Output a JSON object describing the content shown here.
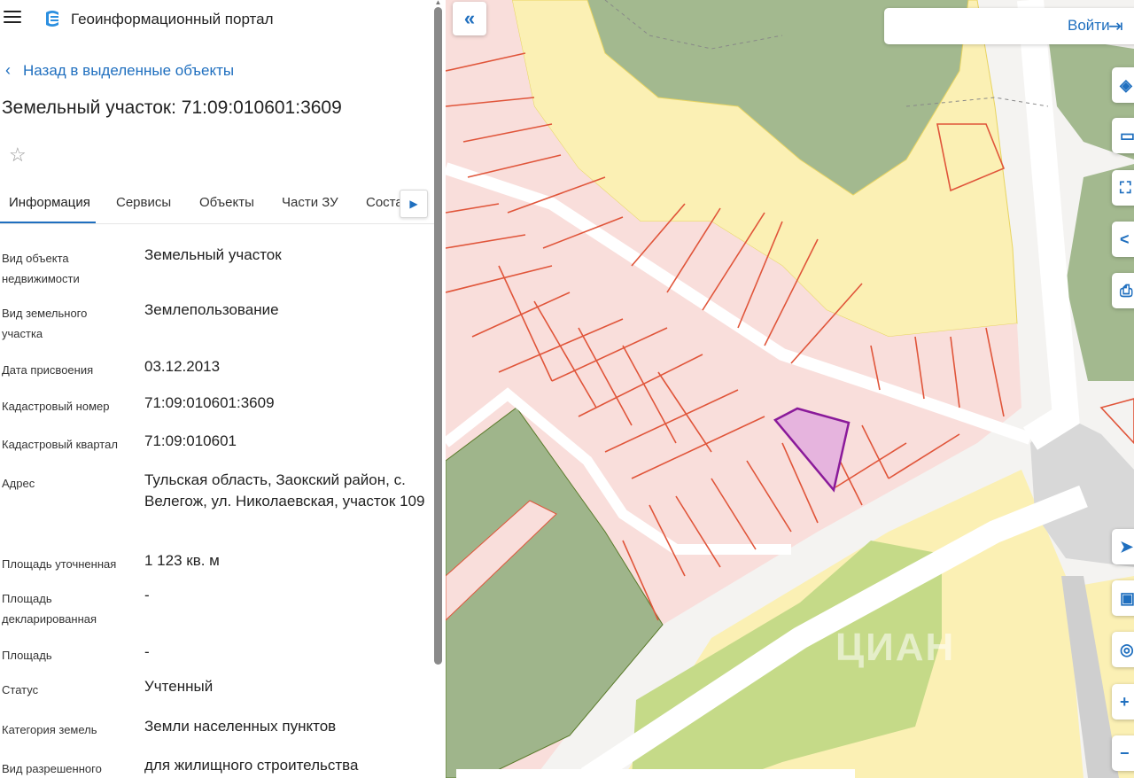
{
  "header": {
    "app_title": "Геоинформационный портал",
    "menu_icon": "menu-icon",
    "logo_icon": "portal-logo-icon"
  },
  "nav": {
    "back_label": "Назад в выделенные объекты"
  },
  "object": {
    "title": "Земельный участок: 71:09:010601:3609"
  },
  "tabs": [
    {
      "label": "Информация"
    },
    {
      "label": "Сервисы"
    },
    {
      "label": "Объекты"
    },
    {
      "label": "Части ЗУ"
    },
    {
      "label": "Состав"
    }
  ],
  "fields": [
    {
      "label": "Вид объекта недвижимости",
      "value": "Земельный участок"
    },
    {
      "label": "Вид земельного участка",
      "value": "Землепользование"
    },
    {
      "label": "Дата присвоения",
      "value": "03.12.2013"
    },
    {
      "label": "Кадастровый номер",
      "value": "71:09:010601:3609"
    },
    {
      "label": "Кадастровый квартал",
      "value": "71:09:010601"
    },
    {
      "label": "Адрес",
      "value": "Тульская область, Заокский район, с. Велегож, ул. Николаевская, участок 109"
    },
    {
      "label": "Площадь уточненная",
      "value": "1 123 кв. м"
    },
    {
      "label": "Площадь декларированная",
      "value": "-"
    },
    {
      "label": "Площадь",
      "value": "-"
    },
    {
      "label": "Статус",
      "value": "Учтенный"
    },
    {
      "label": "Категория земель",
      "value": "Земли населенных пунктов"
    },
    {
      "label": "Вид разрешенного",
      "value": "для жилищного строительства"
    }
  ],
  "map": {
    "login_label": "Войти",
    "collapse_icon": "double-chevron-left-icon",
    "zoom_in": "+",
    "zoom_out": "−",
    "watermark": "ЦИАН",
    "colors": {
      "parcel_fill": "#f9dedb",
      "parcel_stroke": "#e0553a",
      "selected_fill": "#e6b4de",
      "selected_stroke": "#8a1a9a",
      "forest": "#a3b98f",
      "settlement": "#fbf0b4",
      "meadow": "#c5da88",
      "road": "#ffffff",
      "accent": "#1f6fbf"
    }
  }
}
